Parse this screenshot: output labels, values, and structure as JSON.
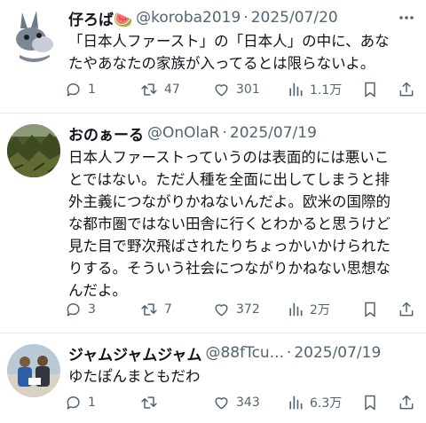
{
  "posts": [
    {
      "name": "仔ろば🍉",
      "handle": "@koroba2019",
      "separator": "·",
      "date": "2025/07/20",
      "lines": [
        "「日本人ファースト」の「日本人」の中に、あな",
        "たやあなたの家族が入ってるとは限らないよ。"
      ],
      "reply_count": "1",
      "retweet_count": "47",
      "like_count": "301",
      "view_count": "1.1万"
    },
    {
      "name": "おのぁーる",
      "handle": "@OnOlaR",
      "separator": "·",
      "date": "2025/07/19",
      "lines": [
        "日本人ファーストっていうのは表面的には悪いこ",
        "とではない。ただ人種を全面に出してしまうと排",
        "外主義につながりかねないんだよ。欧米の国際的",
        "な都市圏ではない田舎に行くとわかると思うけど",
        "見た目で野次飛ばされたりちょっかいかけられた",
        "りする。そういう社会につながりかねない思想な",
        "んだよ。"
      ],
      "reply_count": "3",
      "retweet_count": "7",
      "like_count": "372",
      "view_count": "2万"
    },
    {
      "name": "ジャムジャムジャム",
      "handle": "@88fTcu...",
      "separator": "·",
      "date": "2025/07/19",
      "lines": [
        "ゆたぽんまともだわ"
      ],
      "reply_count": "1",
      "retweet_count": "",
      "like_count": "343",
      "view_count": "6.3万"
    }
  ],
  "icons": {
    "more": "more-icon",
    "reply": "reply-icon",
    "retweet": "retweet-icon",
    "like": "heart-icon",
    "views": "views-icon",
    "bookmark": "bookmark-icon",
    "share": "share-icon"
  },
  "colors": {
    "text": "#0f1419",
    "secondary": "#536471",
    "divider": "#e6e9ec"
  }
}
